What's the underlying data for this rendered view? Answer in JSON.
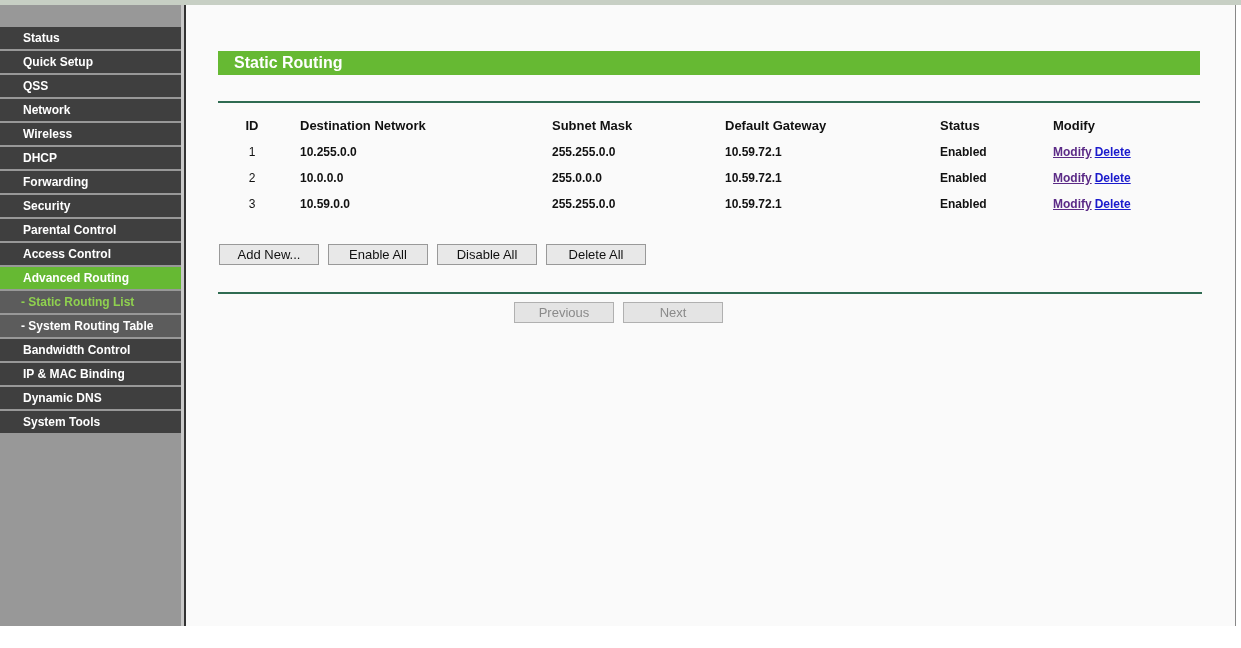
{
  "sidebar": {
    "items": [
      {
        "label": "Status",
        "kind": "main",
        "selected": false
      },
      {
        "label": "Quick Setup",
        "kind": "main",
        "selected": false
      },
      {
        "label": "QSS",
        "kind": "main",
        "selected": false
      },
      {
        "label": "Network",
        "kind": "main",
        "selected": false
      },
      {
        "label": "Wireless",
        "kind": "main",
        "selected": false
      },
      {
        "label": "DHCP",
        "kind": "main",
        "selected": false
      },
      {
        "label": "Forwarding",
        "kind": "main",
        "selected": false
      },
      {
        "label": "Security",
        "kind": "main",
        "selected": false
      },
      {
        "label": "Parental Control",
        "kind": "main",
        "selected": false
      },
      {
        "label": "Access Control",
        "kind": "main",
        "selected": false
      },
      {
        "label": "Advanced Routing",
        "kind": "main",
        "selected": true
      },
      {
        "label": "- Static Routing List",
        "kind": "sub",
        "selected": true
      },
      {
        "label": "- System Routing Table",
        "kind": "sub",
        "selected": false
      },
      {
        "label": "Bandwidth Control",
        "kind": "main",
        "selected": false
      },
      {
        "label": "IP & MAC Binding",
        "kind": "main",
        "selected": false
      },
      {
        "label": "Dynamic DNS",
        "kind": "main",
        "selected": false
      },
      {
        "label": "System Tools",
        "kind": "main",
        "selected": false
      }
    ]
  },
  "section_title": "Static Routing",
  "table": {
    "columns": [
      "ID",
      "Destination Network",
      "Subnet Mask",
      "Default Gateway",
      "Status",
      "Modify"
    ],
    "rows": [
      {
        "id": "1",
        "destination": "10.255.0.0",
        "mask": "255.255.0.0",
        "gateway": "10.59.72.1",
        "status": "Enabled",
        "modify_link": {
          "label": "Modify",
          "visited": true
        },
        "delete_link": {
          "label": "Delete",
          "visited": false
        }
      },
      {
        "id": "2",
        "destination": "10.0.0.0",
        "mask": "255.0.0.0",
        "gateway": "10.59.72.1",
        "status": "Enabled",
        "modify_link": {
          "label": "Modify",
          "visited": true
        },
        "delete_link": {
          "label": "Delete",
          "visited": false
        }
      },
      {
        "id": "3",
        "destination": "10.59.0.0",
        "mask": "255.255.0.0",
        "gateway": "10.59.72.1",
        "status": "Enabled",
        "modify_link": {
          "label": "Modify",
          "visited": true
        },
        "delete_link": {
          "label": "Delete",
          "visited": false
        }
      }
    ]
  },
  "actions": [
    {
      "label": "Add New..."
    },
    {
      "label": "Enable All"
    },
    {
      "label": "Disable All"
    },
    {
      "label": "Delete All"
    }
  ],
  "pager": [
    {
      "label": "Previous",
      "disabled": true
    },
    {
      "label": "Next",
      "disabled": true
    }
  ]
}
